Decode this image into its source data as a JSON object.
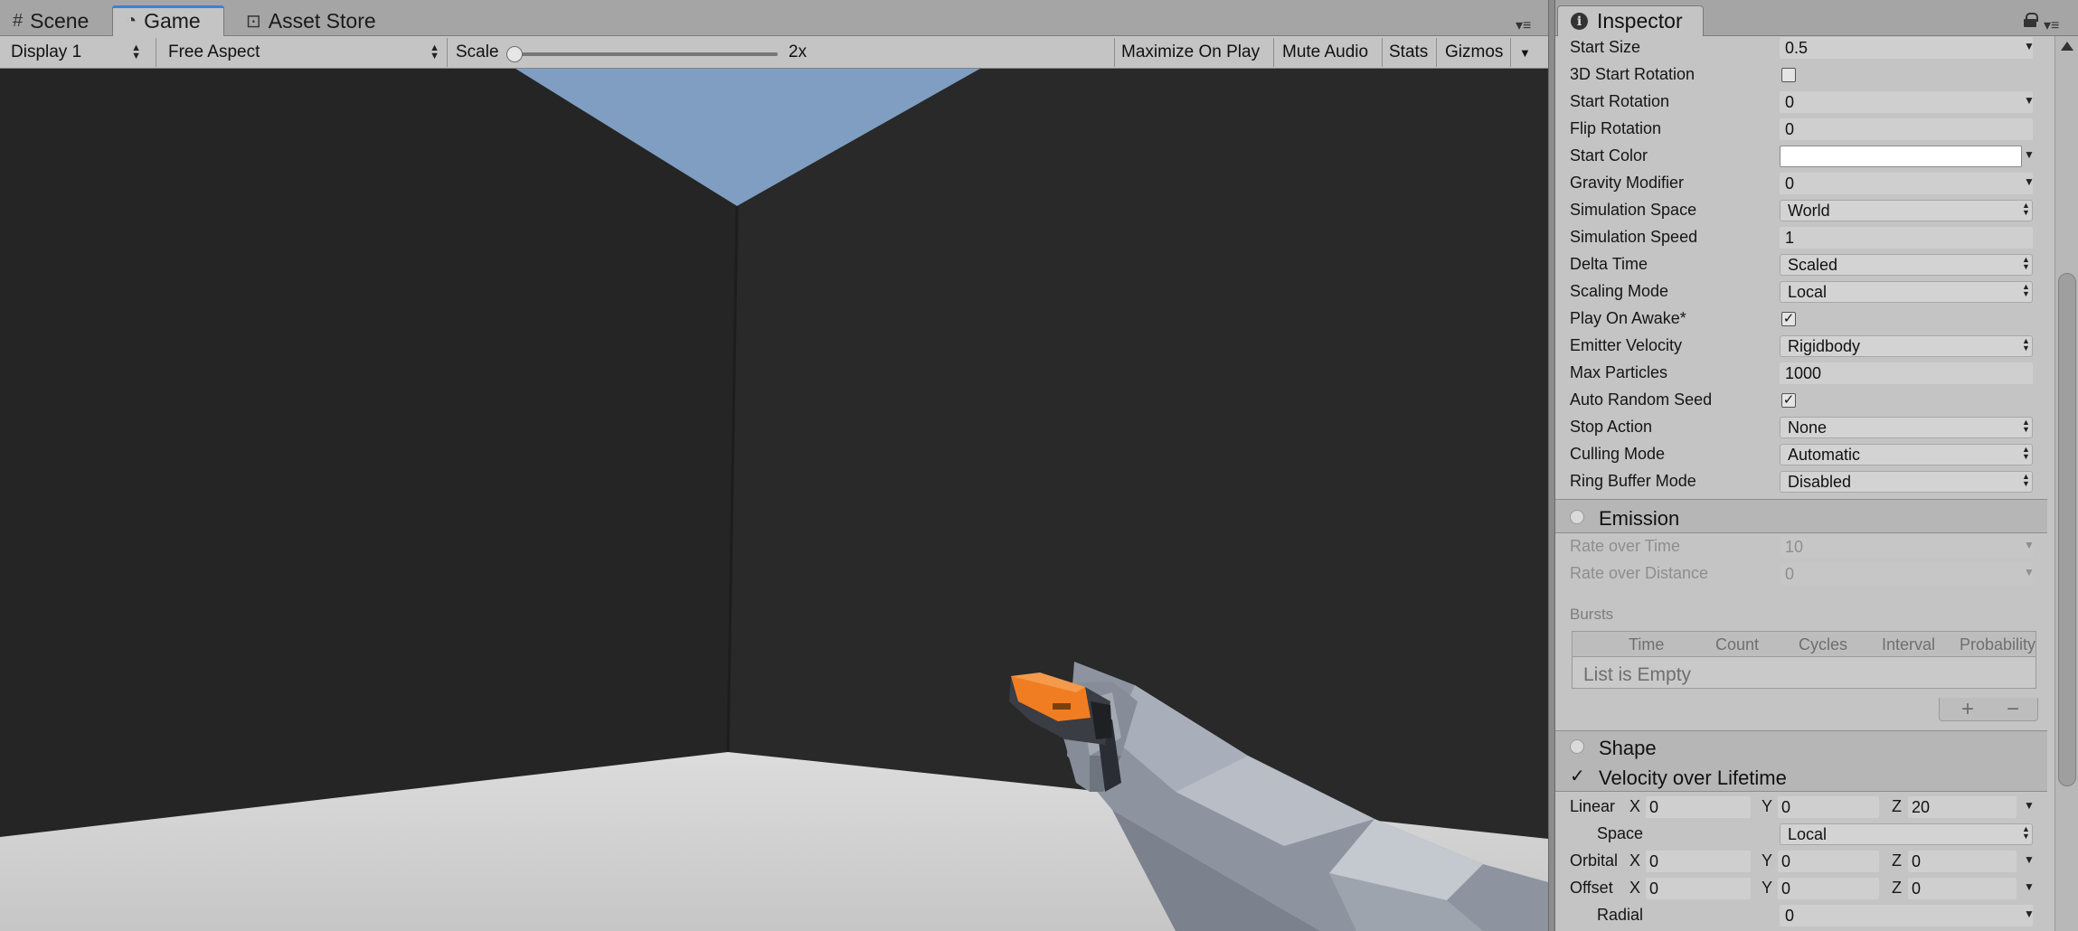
{
  "tabs": {
    "scene": {
      "label": "Scene",
      "icon": "grid-icon"
    },
    "game": {
      "label": "Game",
      "icon": "pacman-icon"
    },
    "asset_store": {
      "label": "Asset Store",
      "icon": "bag-icon"
    }
  },
  "game_toolbar": {
    "display": "Display 1",
    "aspect": "Free Aspect",
    "scale_label": "Scale",
    "scale_value": "2x",
    "scale_slider_fraction": 0.0,
    "maximize_on_play": "Maximize On Play",
    "mute_audio": "Mute Audio",
    "stats": "Stats",
    "gizmos": "Gizmos"
  },
  "inspector": {
    "tab_label": "Inspector",
    "main_rows": [
      {
        "label": "Start Size",
        "value": "0.5",
        "kind": "num-dd"
      },
      {
        "label": "3D Start Rotation",
        "checked": false,
        "kind": "check"
      },
      {
        "label": "Start Rotation",
        "value": "0",
        "kind": "num-dd"
      },
      {
        "label": "Flip Rotation",
        "value": "0",
        "kind": "num"
      },
      {
        "label": "Start Color",
        "value": "#ffffff",
        "kind": "color"
      },
      {
        "label": "Gravity Modifier",
        "value": "0",
        "kind": "num-dd"
      },
      {
        "label": "Simulation Space",
        "value": "World",
        "kind": "drop"
      },
      {
        "label": "Simulation Speed",
        "value": "1",
        "kind": "num"
      },
      {
        "label": "Delta Time",
        "value": "Scaled",
        "kind": "drop"
      },
      {
        "label": "Scaling Mode",
        "value": "Local",
        "kind": "drop"
      },
      {
        "label": "Play On Awake*",
        "checked": true,
        "kind": "check"
      },
      {
        "label": "Emitter Velocity",
        "value": "Rigidbody",
        "kind": "drop"
      },
      {
        "label": "Max Particles",
        "value": "1000",
        "kind": "num"
      },
      {
        "label": "Auto Random Seed",
        "checked": true,
        "kind": "check"
      },
      {
        "label": "Stop Action",
        "value": "None",
        "kind": "drop"
      },
      {
        "label": "Culling Mode",
        "value": "Automatic",
        "kind": "drop"
      },
      {
        "label": "Ring Buffer Mode",
        "value": "Disabled",
        "kind": "drop"
      }
    ],
    "emission": {
      "title": "Emission",
      "enabled": false,
      "rate_over_time_label": "Rate over Time",
      "rate_over_time": "10",
      "rate_over_distance_label": "Rate over Distance",
      "rate_over_distance": "0",
      "bursts_label": "Bursts",
      "bursts_columns": [
        "Time",
        "Count",
        "Cycles",
        "Interval",
        "Probability"
      ],
      "bursts_empty": "List is Empty",
      "add": "+",
      "remove": "−"
    },
    "shape": {
      "title": "Shape",
      "enabled": false
    },
    "velocity": {
      "title": "Velocity over Lifetime",
      "enabled": true,
      "linear_label": "Linear",
      "linear": {
        "x": "0",
        "y": "0",
        "z": "20"
      },
      "space_label": "Space",
      "space": "Local",
      "orbital_label": "Orbital",
      "orbital": {
        "x": "0",
        "y": "0",
        "z": "0"
      },
      "offset_label": "Offset",
      "offset": {
        "x": "0",
        "y": "0",
        "z": "0"
      },
      "radial_label": "Radial",
      "radial": "0",
      "axis_x": "X",
      "axis_y": "Y",
      "axis_z": "Z"
    }
  },
  "colors": {
    "sky": "#7f9ec2",
    "wall": "#262626",
    "floor": "#d4d4d4",
    "gun": "#f07d22",
    "arm": "#9aa0ad",
    "tab_accent": "#3f7fd6"
  }
}
